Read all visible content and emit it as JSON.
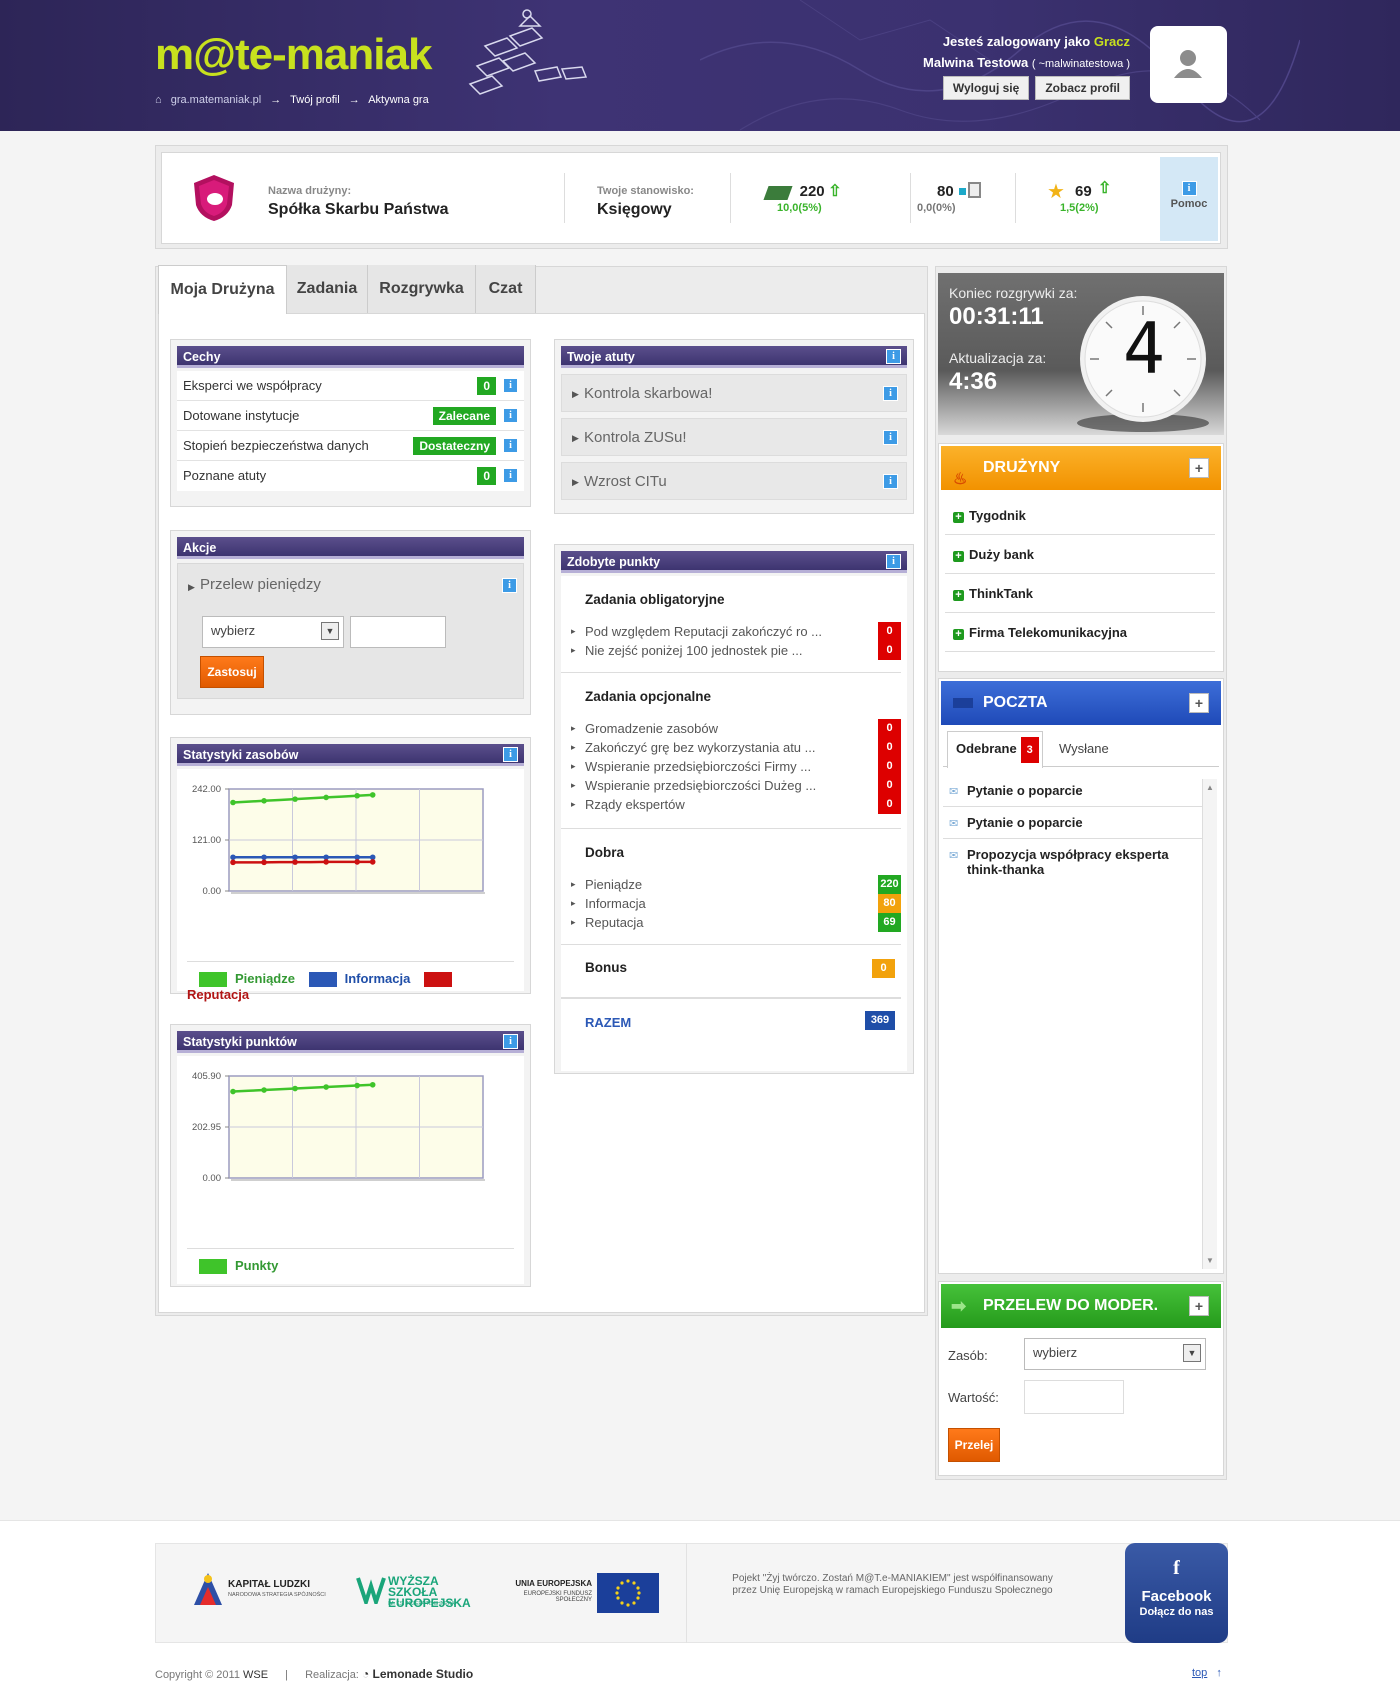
{
  "header": {
    "logo": "m@te-maniak",
    "breadcrumb": [
      "gra.matemaniak.pl",
      "Twój profil",
      "Aktywna gra"
    ],
    "logged_as": "Jesteś zalogowany jako",
    "role": "Gracz",
    "user_name": "Malwina Testowa",
    "user_login": "( ~malwinatestowa )",
    "logout_label": "Wyloguj się",
    "profile_label": "Zobacz profil"
  },
  "teambar": {
    "team_name_label": "Nazwa drużyny:",
    "team_name": "Spółka Skarbu Państwa",
    "position_label": "Twoje stanowisko:",
    "position": "Księgowy",
    "money_value": "220",
    "money_change": "10,0(5%)",
    "info_value": "80",
    "info_change": "0,0(0%)",
    "rep_value": "69",
    "rep_change": "1,5(2%)",
    "help_label": "Pomoc",
    "colors": {
      "up": "#3ab42b",
      "neutral": "#1da9c9",
      "muted": "#777777"
    }
  },
  "tabs": [
    "Moja Drużyna",
    "Zadania",
    "Rozgrywka",
    "Czat"
  ],
  "cechy": {
    "title": "Cechy",
    "rows": [
      {
        "label": "Eksperci we współpracy",
        "value": "0"
      },
      {
        "label": "Dotowane instytucje",
        "value": "Zalecane"
      },
      {
        "label": "Stopień bezpieczeństwa danych",
        "value": "Dostateczny"
      },
      {
        "label": "Poznane atuty",
        "value": "0"
      }
    ]
  },
  "akcje": {
    "title": "Akcje",
    "item": "Przelew pieniędzy",
    "select": "wybierz",
    "apply": "Zastosuj"
  },
  "stat_res": {
    "title": "Statystyki zasobów",
    "legend": [
      "Pieniądze",
      "Informacja",
      "Reputacja"
    ]
  },
  "stat_pts": {
    "title": "Statystyki punktów",
    "legend": [
      "Punkty"
    ]
  },
  "chart_data": [
    {
      "type": "line",
      "title": "Statystyki zasobów",
      "ylim": [
        0,
        242
      ],
      "yticks": [
        "242.00",
        "121.00",
        "0.00"
      ],
      "grid": true,
      "series": [
        {
          "name": "Pieniądze",
          "color": "#3fc42a",
          "values": [
            210,
            212,
            214,
            216,
            218,
            220,
            222,
            224,
            226,
            228
          ]
        },
        {
          "name": "Informacja",
          "color": "#2b58b6",
          "values": [
            80,
            80,
            80,
            80,
            80,
            80,
            80,
            80,
            80,
            80
          ]
        },
        {
          "name": "Reputacja",
          "color": "#cc1111",
          "values": [
            68,
            68,
            68,
            68.5,
            68.5,
            68.5,
            69,
            69,
            69,
            69
          ]
        }
      ]
    },
    {
      "type": "line",
      "title": "Statystyki punktów",
      "ylim": [
        0,
        405.9
      ],
      "yticks": [
        "405.90",
        "202.95",
        "0.00"
      ],
      "grid": true,
      "series": [
        {
          "name": "Punkty",
          "color": "#3fc42a",
          "values": [
            344,
            347,
            350,
            353,
            356,
            359,
            362,
            365,
            368,
            371
          ]
        }
      ]
    }
  ],
  "atuty": {
    "title": "Twoje atuty",
    "items": [
      "Kontrola skarbowa!",
      "Kontrola ZUSu!",
      "Wzrost CITu"
    ]
  },
  "punkty": {
    "title": "Zdobyte punkty",
    "obligatory_title": "Zadania obligatoryjne",
    "obligatory": [
      {
        "label": "Pod względem Reputacji zakończyć ro ...",
        "value": "0"
      },
      {
        "label": "Nie zejść poniżej 100 jednostek pie ...",
        "value": "0"
      }
    ],
    "optional_title": "Zadania opcjonalne",
    "optional": [
      {
        "label": "Gromadzenie zasobów",
        "value": "0"
      },
      {
        "label": "Zakończyć grę bez wykorzystania atu ...",
        "value": "0"
      },
      {
        "label": "Wspieranie przedsiębiorczości Firmy ...",
        "value": "0"
      },
      {
        "label": "Wspieranie przedsiębiorczości Dużeg ...",
        "value": "0"
      },
      {
        "label": "Rządy ekspertów",
        "value": "0"
      }
    ],
    "goods_title": "Dobra",
    "goods": [
      {
        "label": "Pieniądze",
        "value": "220",
        "color": "#22a822"
      },
      {
        "label": "Informacja",
        "value": "80",
        "color": "#f2a20c"
      },
      {
        "label": "Reputacja",
        "value": "69",
        "color": "#22a822"
      }
    ],
    "bonus_label": "Bonus",
    "bonus_value": "0",
    "total_label": "RAZEM",
    "total_value": "369"
  },
  "timer": {
    "end_label": "Koniec rozgrywki za:",
    "end_value": "00:31:11",
    "update_label": "Aktualizacja za:",
    "update_value": "4:36",
    "clock_digit": "4"
  },
  "druzyny": {
    "title": "DRUŻYNY",
    "items": [
      "Tygodnik",
      "Duży bank",
      "ThinkTank",
      "Firma Telekomunikacyjna"
    ]
  },
  "poczta": {
    "title": "POCZTA",
    "tab_received": "Odebrane",
    "received_count": "3",
    "tab_sent": "Wysłane",
    "messages": [
      "Pytanie o poparcie",
      "Pytanie o poparcie",
      "Propozycja współpracy eksperta think-thanka"
    ]
  },
  "przelew": {
    "title": "PRZELEW DO MODER.",
    "resource_label": "Zasób:",
    "resource_value": "wybierz",
    "value_label": "Wartość:",
    "submit": "Przelej"
  },
  "footer": {
    "logo1": "KAPITAŁ LUDZKI",
    "logo1_sub": "NARODOWA STRATEGIA SPÓJNOŚCI",
    "logo2": "WYŻSZA SZKOŁA EUROPEJSKA",
    "logo2_sub": "IM. KS. JÓZEFA TISCHNERA",
    "logo3": "UNIA EUROPEJSKA",
    "logo3_sub": "EUROPEJSKI FUNDUSZ SPOŁECZNY",
    "note_line1": "Pojekt \"Żyj twórczo. Zostań M@T.e-MANIAKIEM\" jest współfinansowany",
    "note_line2": "przez Unię Europejską w ramach Europejskiego Funduszu Społecznego",
    "fb_title": "Facebook",
    "fb_sub": "Dołącz do nas",
    "copyright": "Copyright © 2011",
    "copyright_org": "WSE",
    "made_by_label": "Realizacja:",
    "made_by": "Lemonade Studio",
    "top": "top"
  }
}
